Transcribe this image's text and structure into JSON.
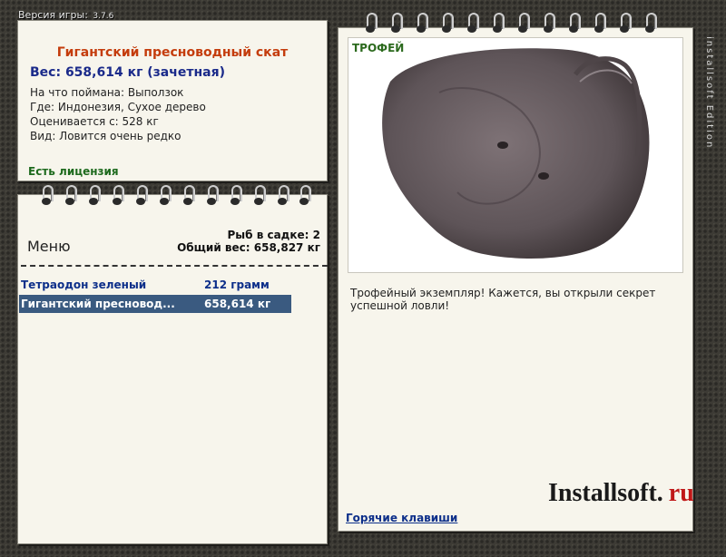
{
  "header": {
    "version_label": "Версия игры:",
    "version_number": "3.7.6"
  },
  "fish_info": {
    "title": "Гигантский пресноводный скат",
    "weight": "Вес: 658,614 кг (зачетная)",
    "caught_on": "На что поймана: Выползок",
    "location": "Где: Индонезия, Сухое дерево",
    "rated_from": "Оценивается с: 528 кг",
    "kind": "Вид: Ловится очень редко",
    "license": "Есть лицензия"
  },
  "menu": {
    "title": "Меню",
    "fish_count": "Рыб в садке: 2",
    "total_weight": "Общий вес: 658,827 кг",
    "rows": [
      {
        "name": "Тетраодон зеленый",
        "weight": "212 грамм"
      },
      {
        "name": "Гигантский пресновод...",
        "weight": "658,614 кг"
      }
    ]
  },
  "trophy": {
    "label": "ТРОФЕЙ",
    "description": "Трофейный экземпляр! Кажется, вы открыли секрет успешной ловли!"
  },
  "footer": {
    "hotkeys": "Горячие клавиши",
    "logo_name": "Installsoft.",
    "logo_domain": "ru"
  },
  "side_caption": "installsoft Edition",
  "colors": {
    "title_accent": "#c43c0c",
    "weight_blue": "#1a2a8a",
    "license_green": "#1d6a1d",
    "selected_row_bg": "#3a5a80"
  },
  "icons": {
    "binder_ring": "binder-ring-icon",
    "fish_image": "stingray-image"
  }
}
